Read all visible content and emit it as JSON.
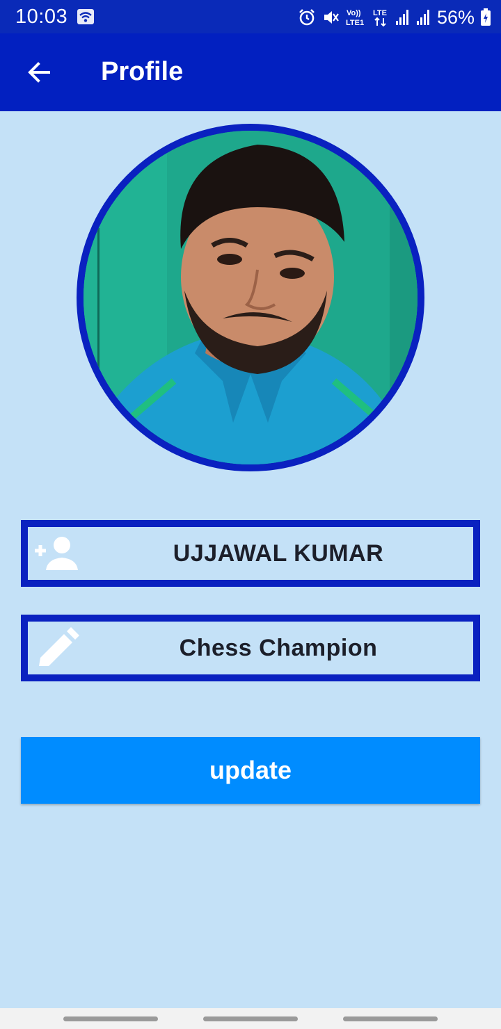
{
  "status_bar": {
    "time": "10:03",
    "battery_percent": "56%",
    "battery_level": 0.56,
    "icons": [
      "wifi-icon",
      "alarm-icon",
      "mute-icon",
      "volte-icon",
      "lte-icon",
      "signal-icon",
      "signal-icon",
      "battery-charging-icon"
    ],
    "volte_label": "Vo)) LTE1",
    "lte_label": "LTE"
  },
  "app_bar": {
    "title": "Profile",
    "back_icon": "arrow-back-icon"
  },
  "profile": {
    "avatar_icon": "profile-photo"
  },
  "fields": {
    "name": {
      "value": "UJJAWAL KUMAR",
      "icon": "person-add-icon"
    },
    "bio": {
      "value": "Chess Champion",
      "icon": "pencil-edit-icon"
    }
  },
  "actions": {
    "update_label": "update"
  },
  "colors": {
    "status_bar": "#0a2ab8",
    "app_bar": "#0220c0",
    "background": "#c4e1f7",
    "accent_border": "#0a21c0",
    "button": "#008cff",
    "text_dark": "#1c1f2a"
  }
}
